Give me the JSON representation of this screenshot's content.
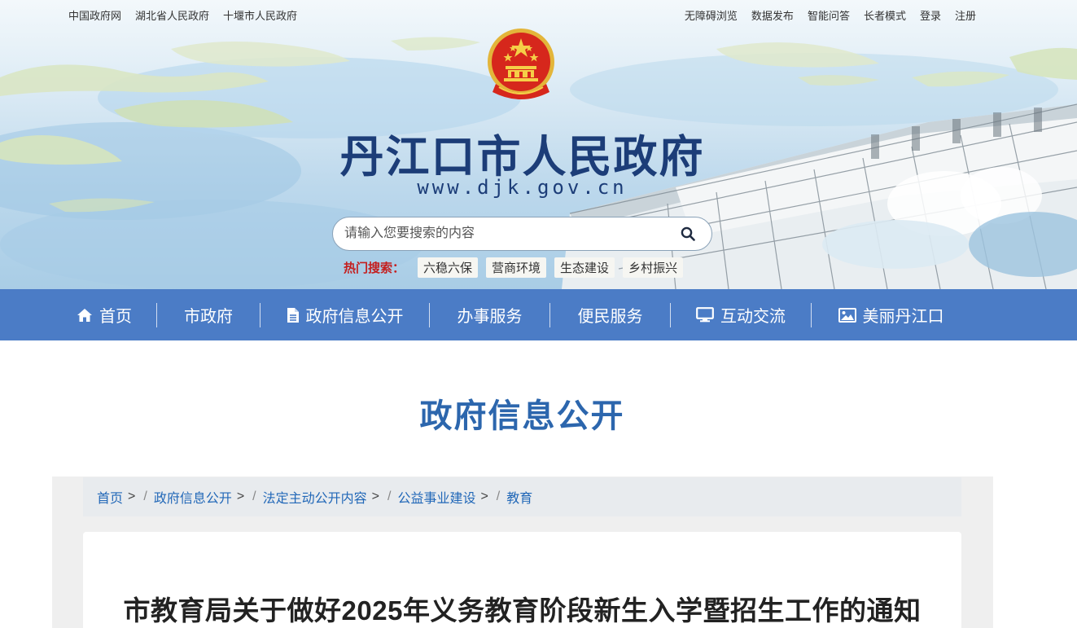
{
  "top_links_left": [
    "中国政府网",
    "湖北省人民政府",
    "十堰市人民政府"
  ],
  "top_links_right": [
    "无障碍浏览",
    "数据发布",
    "智能问答",
    "长者模式",
    "登录",
    "注册"
  ],
  "site": {
    "title": "丹江口市人民政府",
    "url": "www.djk.gov.cn"
  },
  "search": {
    "placeholder": "请输入您要搜索的内容",
    "value": ""
  },
  "hot_search": {
    "label": "热门搜索：",
    "tags": [
      "六稳六保",
      "营商环境",
      "生态建设",
      "乡村振兴"
    ]
  },
  "nav": [
    {
      "label": "首页",
      "icon": "home-icon"
    },
    {
      "label": "市政府",
      "icon": ""
    },
    {
      "label": "政府信息公开",
      "icon": "document-icon"
    },
    {
      "label": "办事服务",
      "icon": ""
    },
    {
      "label": "便民服务",
      "icon": ""
    },
    {
      "label": "互动交流",
      "icon": "monitor-icon"
    },
    {
      "label": "美丽丹江口",
      "icon": "image-icon"
    }
  ],
  "section_title": "政府信息公开",
  "breadcrumb": [
    "首页",
    "政府信息公开",
    "法定主动公开内容",
    "公益事业建设",
    "教育"
  ],
  "breadcrumb_sep": ">",
  "article": {
    "title": "市教育局关于做好2025年义务教育阶段新生入学暨招生工作的通知"
  },
  "colors": {
    "nav_bg": "#4b7cc6",
    "title_blue": "#2c66ad",
    "site_title": "#1c3d78",
    "hot_label": "#c41f1f",
    "link": "#2268b8"
  }
}
